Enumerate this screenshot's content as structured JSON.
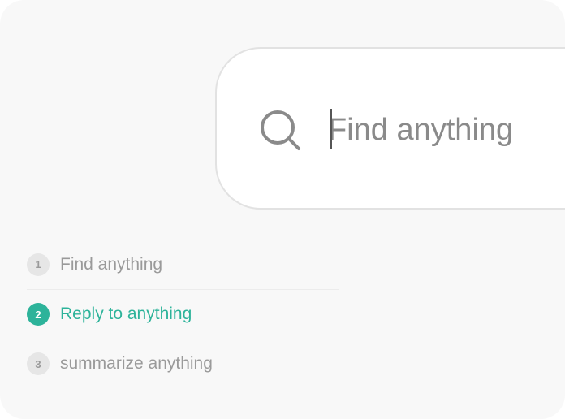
{
  "search": {
    "value": "Find anything",
    "icon": "search-icon"
  },
  "steps": [
    {
      "number": "1",
      "label": "Find anything",
      "active": false
    },
    {
      "number": "2",
      "label": "Reply to anything",
      "active": true
    },
    {
      "number": "3",
      "label": "summarize anything",
      "active": false
    }
  ],
  "colors": {
    "accent": "#2db39a",
    "background": "#f8f8f8",
    "muted_text": "#9a9a9a"
  }
}
